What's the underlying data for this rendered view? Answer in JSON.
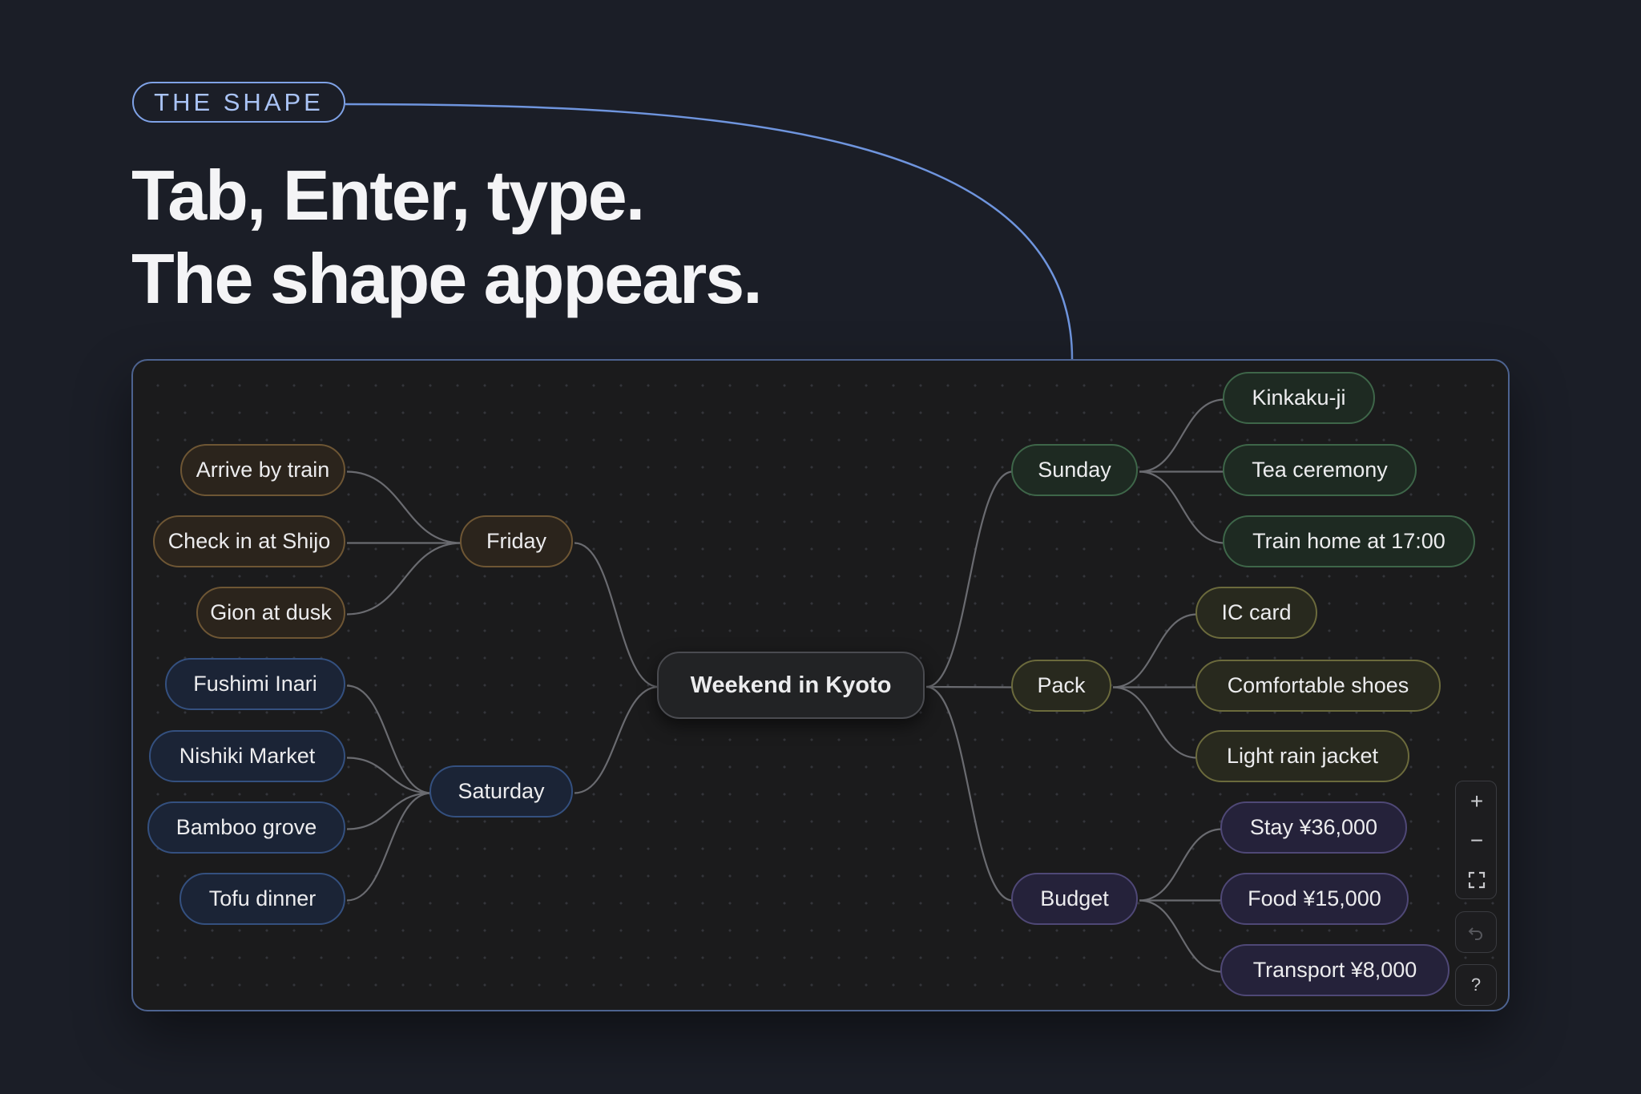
{
  "eyebrow": "THE SHAPE",
  "headline": {
    "line1": "Tab, Enter, type.",
    "line2": "The shape appears."
  },
  "colors": {
    "accent": "#7fa2e6",
    "friday": "#6e5634",
    "saturday": "#34507f",
    "sunday": "#3e6649",
    "pack": "#6b6a3c",
    "budget": "#4f4876"
  },
  "mindmap": {
    "root": "Weekend in Kyoto",
    "left": [
      {
        "label": "Friday",
        "children": [
          "Arrive by train",
          "Check in at Shijo",
          "Gion at dusk"
        ]
      },
      {
        "label": "Saturday",
        "children": [
          "Fushimi Inari",
          "Nishiki Market",
          "Bamboo grove",
          "Tofu dinner"
        ]
      }
    ],
    "right": [
      {
        "label": "Sunday",
        "children": [
          "Kinkaku-ji",
          "Tea ceremony",
          "Train home at 17:00"
        ]
      },
      {
        "label": "Pack",
        "children": [
          "IC card",
          "Comfortable shoes",
          "Light rain jacket"
        ]
      },
      {
        "label": "Budget",
        "children": [
          "Stay ¥36,000",
          "Food ¥15,000",
          "Transport ¥8,000"
        ]
      }
    ]
  },
  "controls": {
    "zoom_in": "+",
    "zoom_out": "−",
    "fit_icon": "fit-to-screen-icon",
    "undo_icon": "undo-icon",
    "help": "?"
  }
}
